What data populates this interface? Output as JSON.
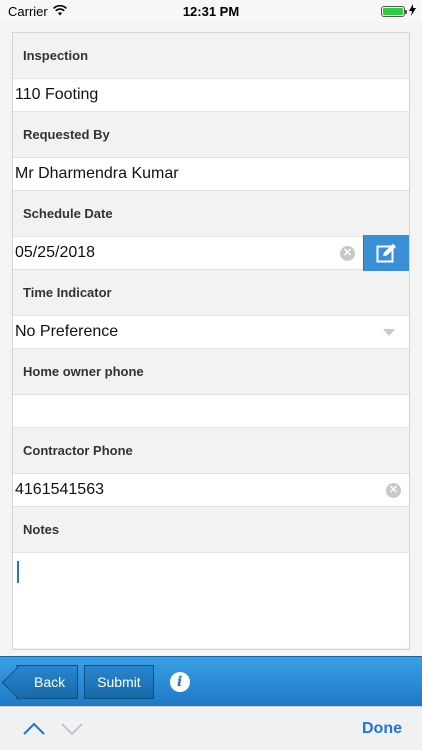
{
  "status_bar": {
    "carrier": "Carrier",
    "time": "12:31 PM",
    "battery_level": 1.0
  },
  "form": {
    "fields": [
      {
        "label": "Inspection",
        "value": "110 Footing"
      },
      {
        "label": "Requested By",
        "value": "Mr Dharmendra Kumar"
      },
      {
        "label": "Schedule Date",
        "value": "05/25/2018"
      },
      {
        "label": "Time Indicator",
        "value": "No Preference"
      },
      {
        "label": "Home owner phone",
        "value": ""
      },
      {
        "label": "Contractor Phone",
        "value": "4161541563"
      },
      {
        "label": "Notes",
        "value": ""
      }
    ]
  },
  "toolbar": {
    "back_label": "Back",
    "submit_label": "Submit"
  },
  "accessory": {
    "done_label": "Done"
  },
  "colors": {
    "toolbar_blue": "#1f79c4",
    "accent_blue": "#3a8fd6",
    "done_blue": "#1f74d6"
  }
}
